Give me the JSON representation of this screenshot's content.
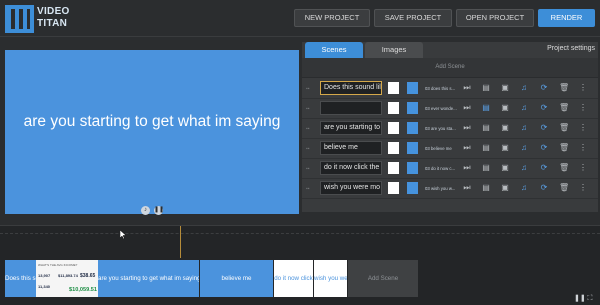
{
  "logo": {
    "line1": "VIDEO",
    "line2": "TITAN"
  },
  "header": {
    "buttons": [
      {
        "label": "NEW PROJECT"
      },
      {
        "label": "SAVE PROJECT"
      },
      {
        "label": "OPEN PROJECT"
      },
      {
        "label": "RENDER"
      }
    ]
  },
  "preview": {
    "text": "are you starting to get what im saying",
    "icons": [
      "volume-icon",
      "pause-icon"
    ]
  },
  "panel": {
    "tabs": [
      {
        "label": "Scenes"
      },
      {
        "label": "Images"
      }
    ],
    "project_settings": "Project settings",
    "add_scene": "Add Scene",
    "scenes": [
      {
        "text": "Does this sound lil",
        "audio": "03 does this s...",
        "selected": true
      },
      {
        "text": "",
        "audio": "03 ever wonde...",
        "selected": false
      },
      {
        "text": "are you starting to",
        "audio": "03 are you sta...",
        "selected": false
      },
      {
        "text": "believe me",
        "audio": "03 believe me",
        "selected": false
      },
      {
        "text": "do it now click the",
        "audio": "03 do it now c...",
        "selected": false
      },
      {
        "text": "wish you were mo",
        "audio": "03 wish you w...",
        "selected": false
      }
    ]
  },
  "timeline": {
    "clips": [
      {
        "label": "Does this sound"
      },
      {
        "label": "are you starting to get what im saying"
      },
      {
        "label": "believe me"
      },
      {
        "label": "do it now click"
      },
      {
        "label": "wish you were"
      },
      {
        "label": "Add Scene"
      }
    ],
    "image_clip": {
      "header": "WHAT'S THE AVG INCOME?",
      "n1": "13,907",
      "n2": "$11,893.74",
      "n3": "$38.65",
      "n4": "11,340",
      "n5": "$10,059.51"
    }
  },
  "colors": {
    "accent": "#3d8ed8",
    "panel": "#393b3d",
    "bg": "#2b2d2f"
  }
}
